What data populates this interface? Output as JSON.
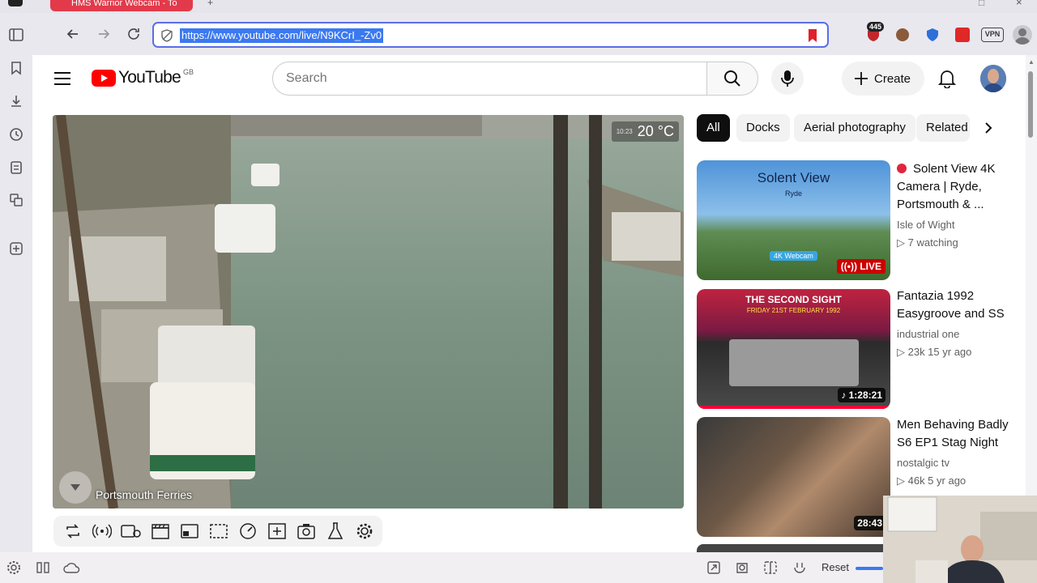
{
  "browser": {
    "tab_title": "HMS Warrior Webcam - To",
    "url": "https://www.youtube.com/live/N9KCrI_-Zv0",
    "badge_count": "445",
    "vpn_label": "VPN"
  },
  "youtube": {
    "logo_text": "YouTube",
    "region": "GB",
    "search_placeholder": "Search",
    "create_label": "Create"
  },
  "player": {
    "temperature": "20 °C",
    "clock": "10:23",
    "location_caption": "Portsmouth Ferries"
  },
  "chips": [
    "All",
    "Docks",
    "Aerial photography",
    "Related"
  ],
  "videos": [
    {
      "title_line1": "Solent View 4K",
      "title_line2": "Camera | Ryde,",
      "title_line3": "Portsmouth & ...",
      "channel": "Isle of Wight",
      "meta": "7 watching",
      "badge": "LIVE",
      "thumb_title": "Solent View",
      "thumb_sub": "Ryde",
      "thumb_tag": "4K Webcam"
    },
    {
      "title_line1": "Fantazia 1992",
      "title_line2": "Easygroove and SS",
      "channel": "industrial one",
      "meta": "23k  15 yr ago",
      "duration": "1:28:21",
      "thumb_title": "THE SECOND SIGHT",
      "thumb_sub": "FRIDAY 21ST FEBRUARY 1992"
    },
    {
      "title_line1": "Men Behaving Badly",
      "title_line2": "S6 EP1  Stag Night",
      "channel": "nostalgic tv",
      "meta": "46k  5 yr ago",
      "duration": "28:43"
    }
  ],
  "bottom": {
    "reset_label": "Reset"
  },
  "colors": {
    "accent": "#3b79f0",
    "youtube_red": "#ff0000",
    "live_red": "#cc0000"
  }
}
